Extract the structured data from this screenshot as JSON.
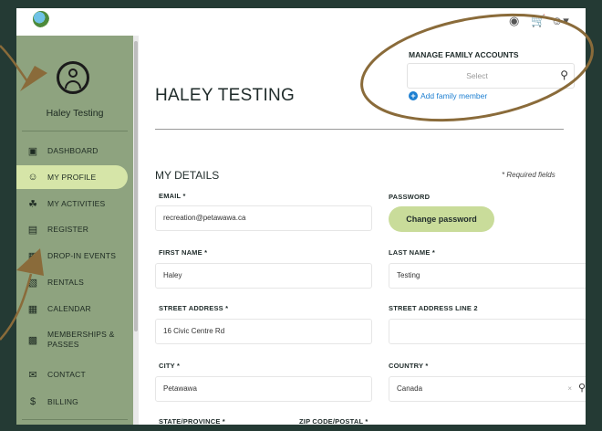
{
  "top_icons": {
    "globe": "globe-icon",
    "cart": "cart-icon",
    "account": "account-dropdown-icon"
  },
  "sidebar": {
    "user_name": "Haley Testing",
    "items": [
      {
        "label": "DASHBOARD",
        "icon": "▣",
        "active": false
      },
      {
        "label": "MY PROFILE",
        "icon": "☺",
        "active": true
      },
      {
        "label": "MY ACTIVITIES",
        "icon": "☘",
        "active": false
      },
      {
        "label": "REGISTER",
        "icon": "▤",
        "active": false
      },
      {
        "label": "DROP-IN EVENTS",
        "icon": "▦",
        "active": false
      },
      {
        "label": "RENTALS",
        "icon": "▧",
        "active": false
      },
      {
        "label": "CALENDAR",
        "icon": "▦",
        "active": false
      },
      {
        "label": "MEMBERSHIPS & PASSES",
        "icon": "▩",
        "active": false
      },
      {
        "label": "CONTACT",
        "icon": "✉",
        "active": false
      },
      {
        "label": "BILLING",
        "icon": "$",
        "active": false
      }
    ]
  },
  "header": {
    "title": "HALEY TESTING",
    "manage_label": "MANAGE FAMILY ACCOUNTS",
    "manage_placeholder": "Select",
    "add_family": "Add family member"
  },
  "details": {
    "title": "MY DETAILS",
    "required_note": "* Required fields",
    "email_label": "EMAIL *",
    "email_value": "recreation@petawawa.ca",
    "password_label": "PASSWORD",
    "change_password": "Change password",
    "first_name_label": "FIRST NAME *",
    "first_name_value": "Haley",
    "last_name_label": "LAST NAME *",
    "last_name_value": "Testing",
    "street_label": "STREET ADDRESS *",
    "street_value": "16 Civic Centre Rd",
    "street2_label": "STREET ADDRESS LINE 2",
    "street2_value": "",
    "city_label": "CITY *",
    "city_value": "Petawawa",
    "country_label": "COUNTRY *",
    "country_value": "Canada",
    "state_label": "STATE/PROVINCE *",
    "zip_label": "ZIP CODE/POSTAL *"
  },
  "colors": {
    "sidebar": "#8ea37f",
    "active": "#d6e5a8",
    "button": "#c9dc9a",
    "annotation": "#8a6b3a",
    "frame": "#243a34"
  }
}
